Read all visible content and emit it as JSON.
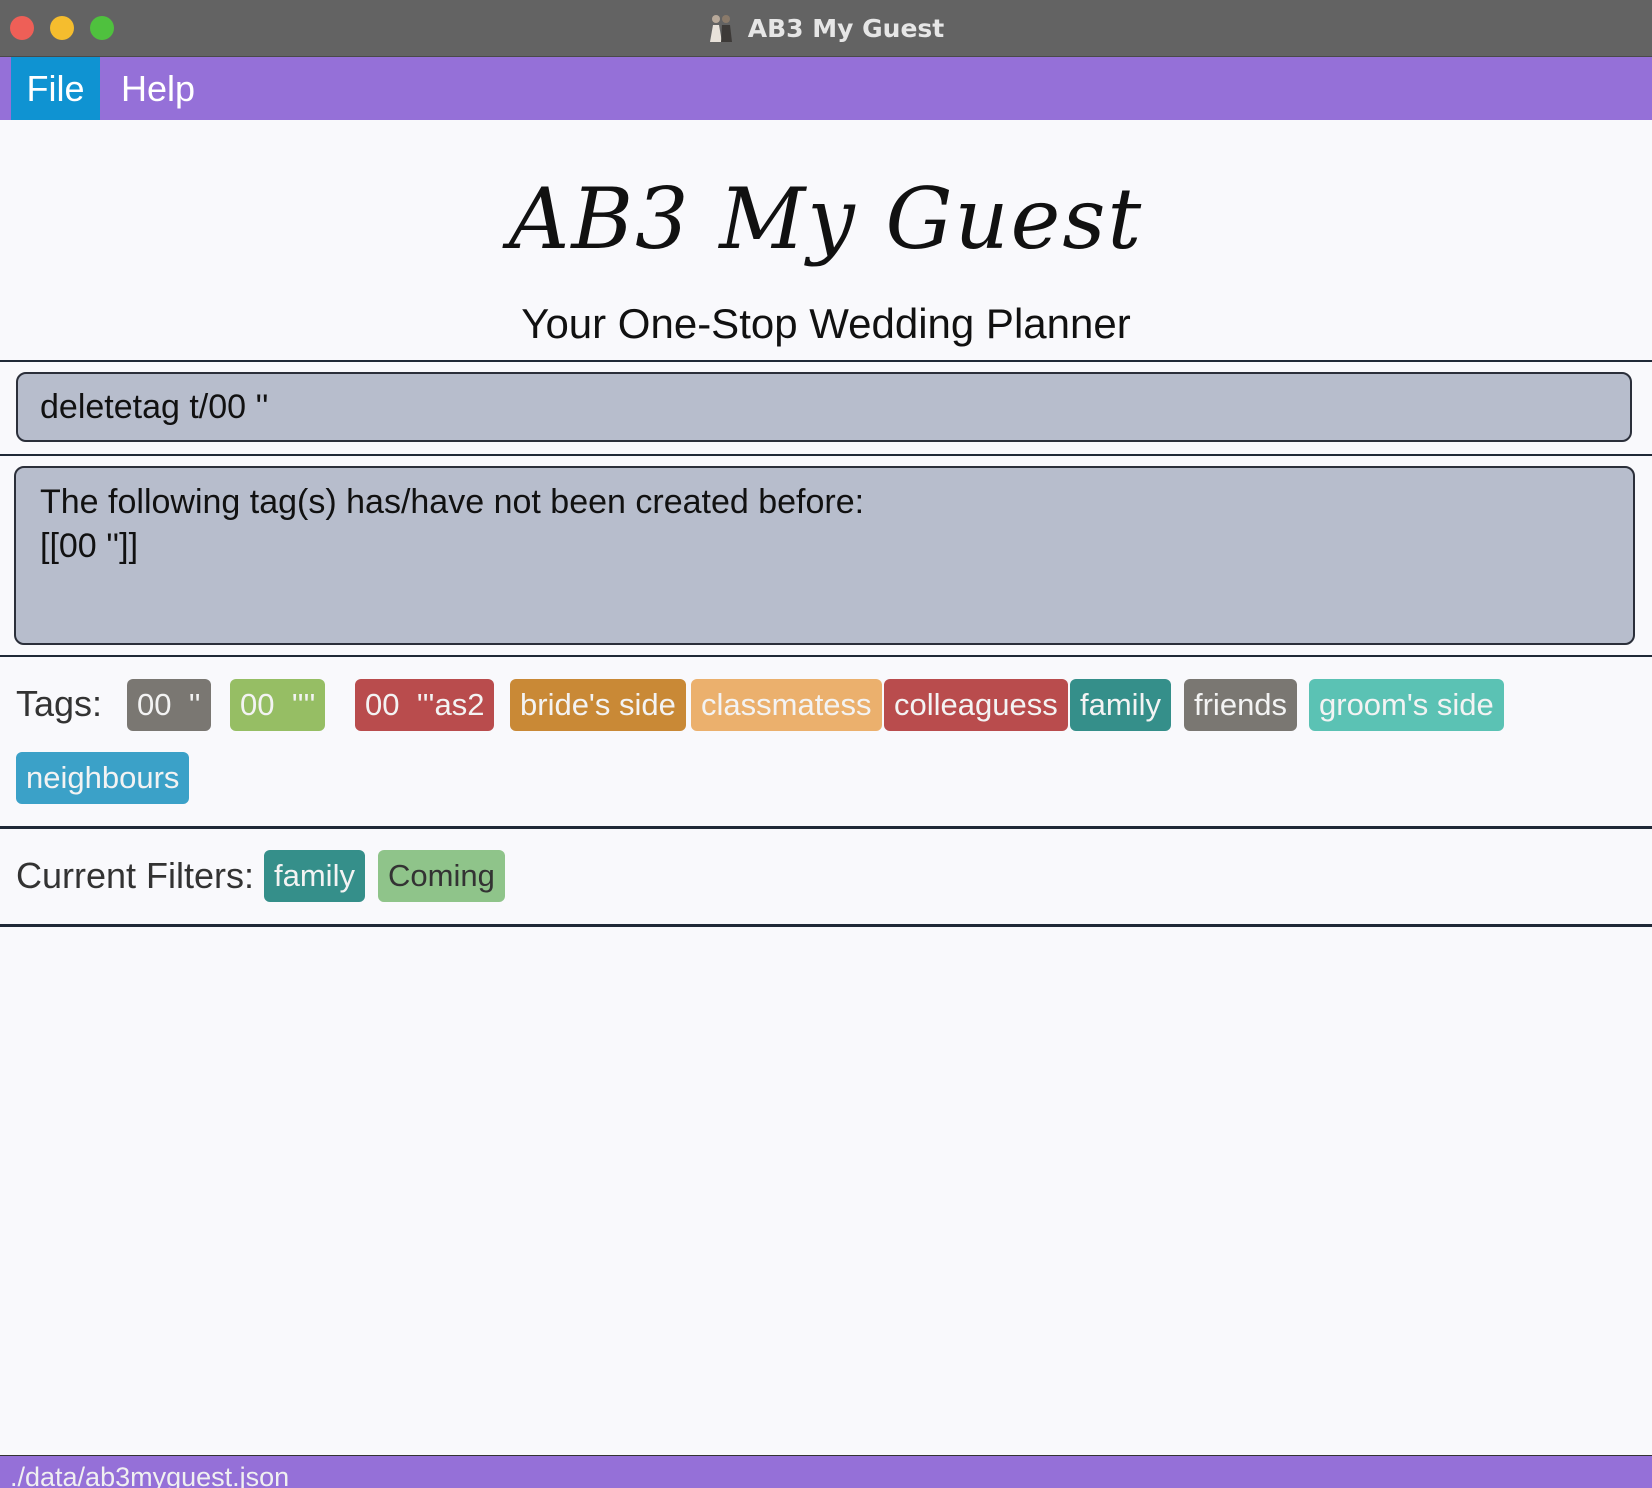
{
  "window": {
    "title": "AB3 My Guest"
  },
  "menu": {
    "file": "File",
    "help": "Help"
  },
  "header": {
    "logo": "AB3 My Guest",
    "subtitle": "Your One-Stop Wedding Planner"
  },
  "command": {
    "value": "deletetag t/00 ''"
  },
  "result": {
    "text": "The following tag(s) has/have not been created before:\n[[00 '']]"
  },
  "tags": {
    "label": "Tags:",
    "items": [
      {
        "label": "00  ''",
        "color": "#7a7772",
        "text_color": "#f3f3f3"
      },
      {
        "label": "00  ''''",
        "color": "#96be64",
        "text_color": "#f3f3f3"
      },
      {
        "label": "00  '''as2",
        "color": "#b94c4d",
        "text_color": "#f3f3f3"
      },
      {
        "label": "bride's side",
        "color": "#c98936",
        "text_color": "#f3f3f3"
      },
      {
        "label": "classmatess",
        "color": "#ebb06d",
        "text_color": "#f3f3f3"
      },
      {
        "label": "colleaguess",
        "color": "#b94c4d",
        "text_color": "#f3f3f3"
      },
      {
        "label": "family",
        "color": "#358f8a",
        "text_color": "#f3f3f3"
      },
      {
        "label": "friends",
        "color": "#7a7772",
        "text_color": "#f3f3f3"
      },
      {
        "label": "groom's side",
        "color": "#5bc2b4",
        "text_color": "#f3f3f3"
      },
      {
        "label": "neighbours",
        "color": "#3ba1c8",
        "text_color": "#f3f3f3"
      }
    ]
  },
  "filters": {
    "label": "Current Filters:",
    "items": [
      {
        "label": "family",
        "color": "#358f8a",
        "text_color": "#f3f3f3"
      },
      {
        "label": "Coming",
        "color": "#8fc48a",
        "text_color": "#333333"
      }
    ]
  },
  "status": {
    "path": "./data/ab3myguest.json"
  }
}
